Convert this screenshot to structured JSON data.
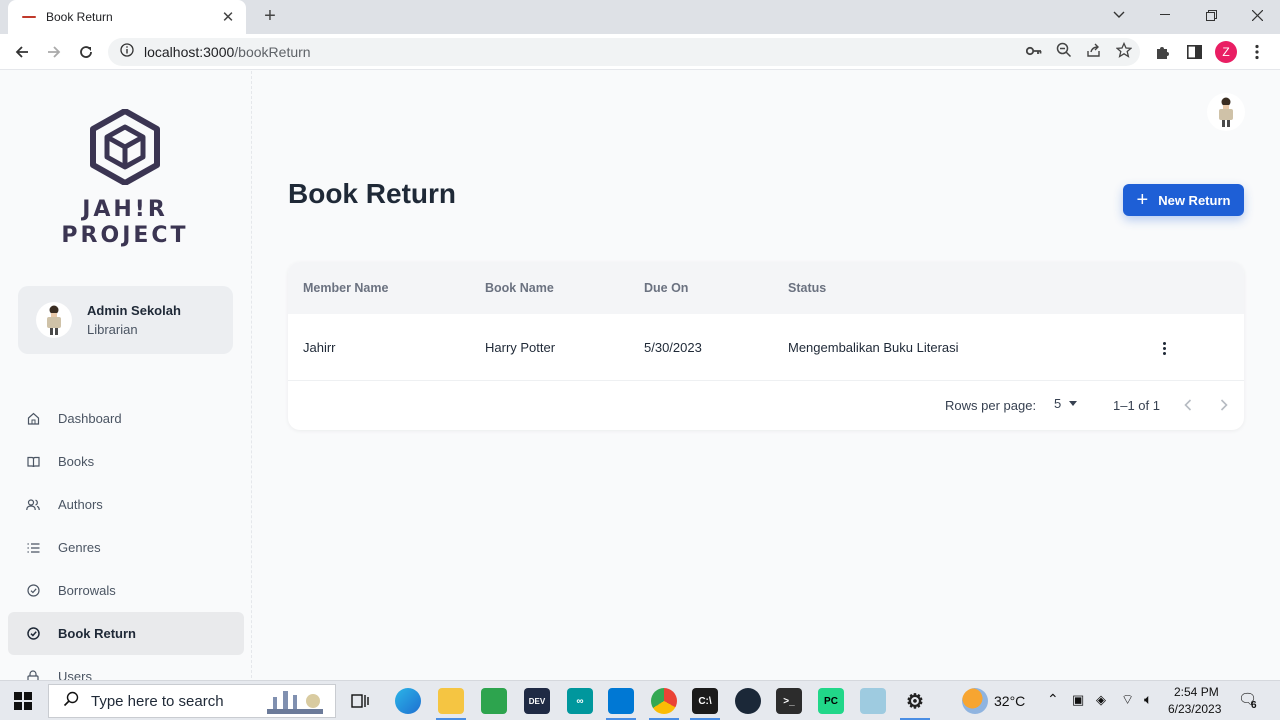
{
  "browser": {
    "tab_title": "Book Return",
    "url_host": "localhost:3000",
    "url_path": "/bookReturn",
    "profile_initial": "Z"
  },
  "sidebar": {
    "logo_line1": "JAH!R",
    "logo_line2": "PROJECT",
    "account": {
      "name": "Admin Sekolah",
      "role": "Librarian"
    },
    "items": [
      {
        "label": "Dashboard",
        "icon": "home-icon"
      },
      {
        "label": "Books",
        "icon": "book-icon"
      },
      {
        "label": "Authors",
        "icon": "users-icon"
      },
      {
        "label": "Genres",
        "icon": "list-icon"
      },
      {
        "label": "Borrowals",
        "icon": "check-circle-icon"
      },
      {
        "label": "Book Return",
        "icon": "check-circle-icon",
        "active": true
      },
      {
        "label": "Users",
        "icon": "lock-icon"
      }
    ]
  },
  "main": {
    "title": "Book Return",
    "new_button": "New Return",
    "table": {
      "headers": [
        "Member Name",
        "Book Name",
        "Due On",
        "Status"
      ],
      "rows": [
        {
          "member": "Jahirr",
          "book": "Harry Potter",
          "due": "5/30/2023",
          "status": "Mengembalikan Buku Literasi"
        }
      ]
    },
    "pagination": {
      "rows_label": "Rows per page:",
      "rows_value": "5",
      "range": "1–1 of 1"
    }
  },
  "taskbar": {
    "search_placeholder": "Type here to search",
    "temperature": "32°C",
    "time": "2:54 PM",
    "date": "6/23/2023",
    "notification_count": "6"
  },
  "colors": {
    "accent": "#1e5fd6",
    "logo": "#3b3552",
    "profile": "#e91e63"
  }
}
